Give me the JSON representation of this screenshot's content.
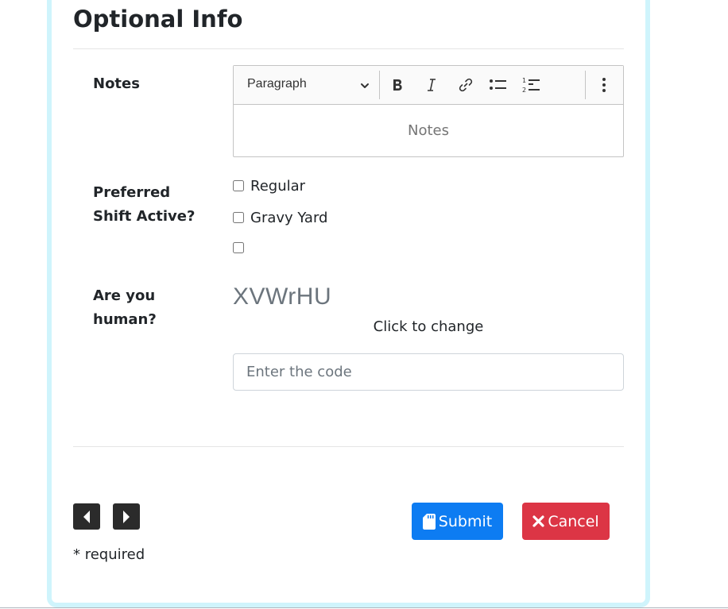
{
  "section": {
    "title": "Optional Info"
  },
  "notes": {
    "label": "Notes",
    "heading_select": "Paragraph",
    "toolbar": {
      "bold_icon": "bold-icon",
      "italic_icon": "italic-icon",
      "link_icon": "link-icon",
      "bulleted_list_icon": "bulleted-list-icon",
      "numbered_list_icon": "numbered-list-icon",
      "more_icon": "vertical-ellipsis-icon"
    },
    "placeholder": "Notes"
  },
  "preferred_shift": {
    "label": "Preferred Shift Active?",
    "options": [
      {
        "label": "Regular",
        "checked": false
      },
      {
        "label": "Gravy Yard",
        "checked": false
      },
      {
        "label": "",
        "checked": false
      }
    ]
  },
  "captcha": {
    "label": "Are you human?",
    "code": "XVWrHU",
    "change_text": "Click to change",
    "input_placeholder": "Enter the code",
    "input_value": ""
  },
  "navigation": {
    "prev_icon": "caret-left-icon",
    "next_icon": "caret-right-icon"
  },
  "footer": {
    "required_note": "* required",
    "submit_label": "Submit",
    "cancel_label": "Cancel",
    "submit_icon": "sd-card-icon",
    "cancel_icon": "close-icon"
  },
  "colors": {
    "card_border": "#cff4fc",
    "submit_bg": "#0d7cf2",
    "cancel_bg": "#dc3545",
    "nav_bg": "#2b2b2b"
  }
}
